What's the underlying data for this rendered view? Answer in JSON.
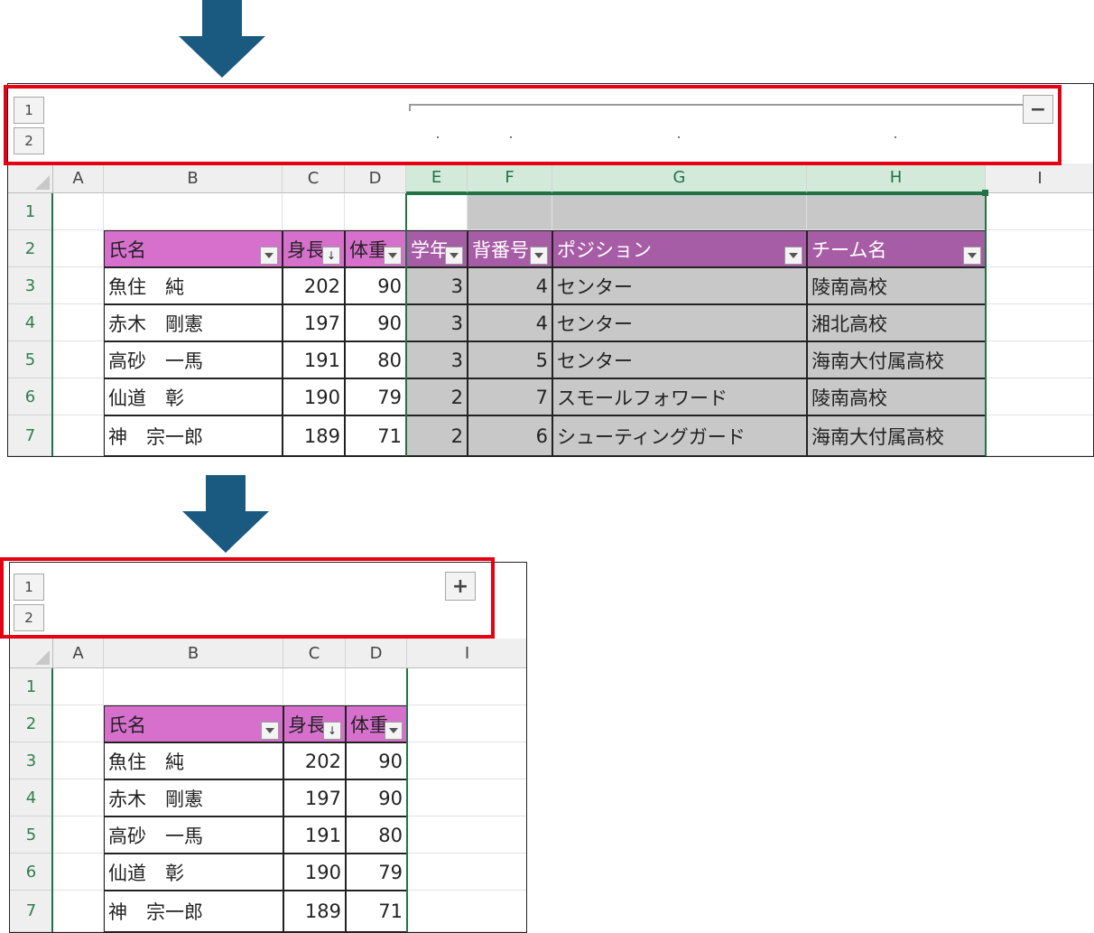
{
  "top": {
    "level_buttons": [
      "1",
      "2"
    ],
    "group_button": "−",
    "columns": [
      "A",
      "B",
      "C",
      "D",
      "E",
      "F",
      "G",
      "H",
      "I"
    ],
    "rows": [
      "1",
      "2",
      "3",
      "4",
      "5",
      "6",
      "7"
    ],
    "headers": {
      "b": "氏名",
      "c": "身長",
      "d": "体重",
      "e": "学年",
      "f": "背番号",
      "g": "ポジション",
      "h": "チーム名"
    },
    "data": [
      {
        "name": "魚住　純",
        "height": "202",
        "weight": "90",
        "grade": "3",
        "number": "4",
        "position": "センター",
        "team": "陵南高校"
      },
      {
        "name": "赤木　剛憲",
        "height": "197",
        "weight": "90",
        "grade": "3",
        "number": "4",
        "position": "センター",
        "team": "湘北高校"
      },
      {
        "name": "高砂　一馬",
        "height": "191",
        "weight": "80",
        "grade": "3",
        "number": "5",
        "position": "センター",
        "team": "海南大付属高校"
      },
      {
        "name": "仙道　彰",
        "height": "190",
        "weight": "79",
        "grade": "2",
        "number": "7",
        "position": "スモールフォワード",
        "team": "陵南高校"
      },
      {
        "name": "神　宗一郎",
        "height": "189",
        "weight": "71",
        "grade": "2",
        "number": "6",
        "position": "シューティングガード",
        "team": "海南大付属高校"
      }
    ]
  },
  "bottom": {
    "level_buttons": [
      "1",
      "2"
    ],
    "group_button": "+",
    "columns": [
      "A",
      "B",
      "C",
      "D",
      "I"
    ],
    "rows": [
      "1",
      "2",
      "3",
      "4",
      "5",
      "6",
      "7"
    ],
    "headers": {
      "b": "氏名",
      "c": "身長",
      "d": "体重"
    },
    "data": [
      {
        "name": "魚住　純",
        "height": "202",
        "weight": "90"
      },
      {
        "name": "赤木　剛憲",
        "height": "197",
        "weight": "90"
      },
      {
        "name": "高砂　一馬",
        "height": "191",
        "weight": "80"
      },
      {
        "name": "仙道　彰",
        "height": "190",
        "weight": "79"
      },
      {
        "name": "神　宗一郎",
        "height": "189",
        "weight": "71"
      }
    ]
  },
  "colors": {
    "arrow": "#1b5a80",
    "highlight_box": "#e60012",
    "header_pink": "#d770cd",
    "header_purple": "#a75ca6",
    "selection_gray": "#c8c8c8",
    "excel_green": "#217346"
  }
}
